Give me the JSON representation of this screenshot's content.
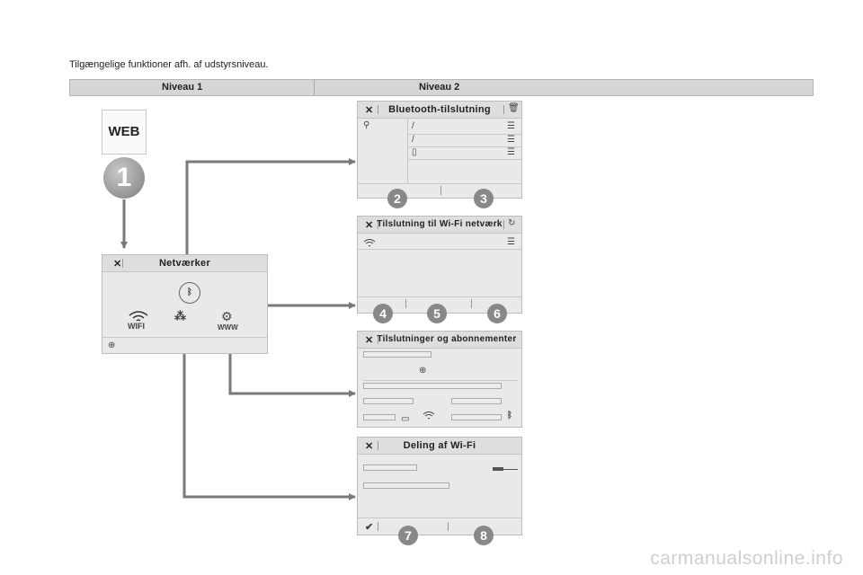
{
  "intro": "Tilgængelige funktioner afh. af udstyrsniveau.",
  "levels": [
    "Niveau 1",
    "Niveau 2"
  ],
  "web_label": "WEB",
  "step_main": "1",
  "panels": {
    "networks": {
      "title": "Netværker",
      "wifi_label": "WIFI",
      "www_label": "WWW"
    },
    "bluetooth": {
      "title": "Bluetooth-tilslutning",
      "steps": [
        "2",
        "3"
      ]
    },
    "wifi_connect": {
      "title": "Tilslutning til Wi-Fi netværk",
      "steps": [
        "4",
        "5",
        "6"
      ]
    },
    "subscriptions": {
      "title": "Tilslutninger og abonnementer"
    },
    "wifi_share": {
      "title": "Deling af Wi-Fi",
      "steps": [
        "7",
        "8"
      ]
    }
  },
  "watermark": "carmanualsonline.info",
  "colors": {
    "arrow": "#7a7a7a",
    "panel": "#e9e9e9",
    "header": "#dedede",
    "badge": "#888888"
  },
  "icons": [
    "close-icon",
    "trash-icon",
    "search-icon",
    "phone-icon",
    "refresh-icon",
    "wifi-icon",
    "bluetooth-icon",
    "globe-icon",
    "check-icon"
  ]
}
